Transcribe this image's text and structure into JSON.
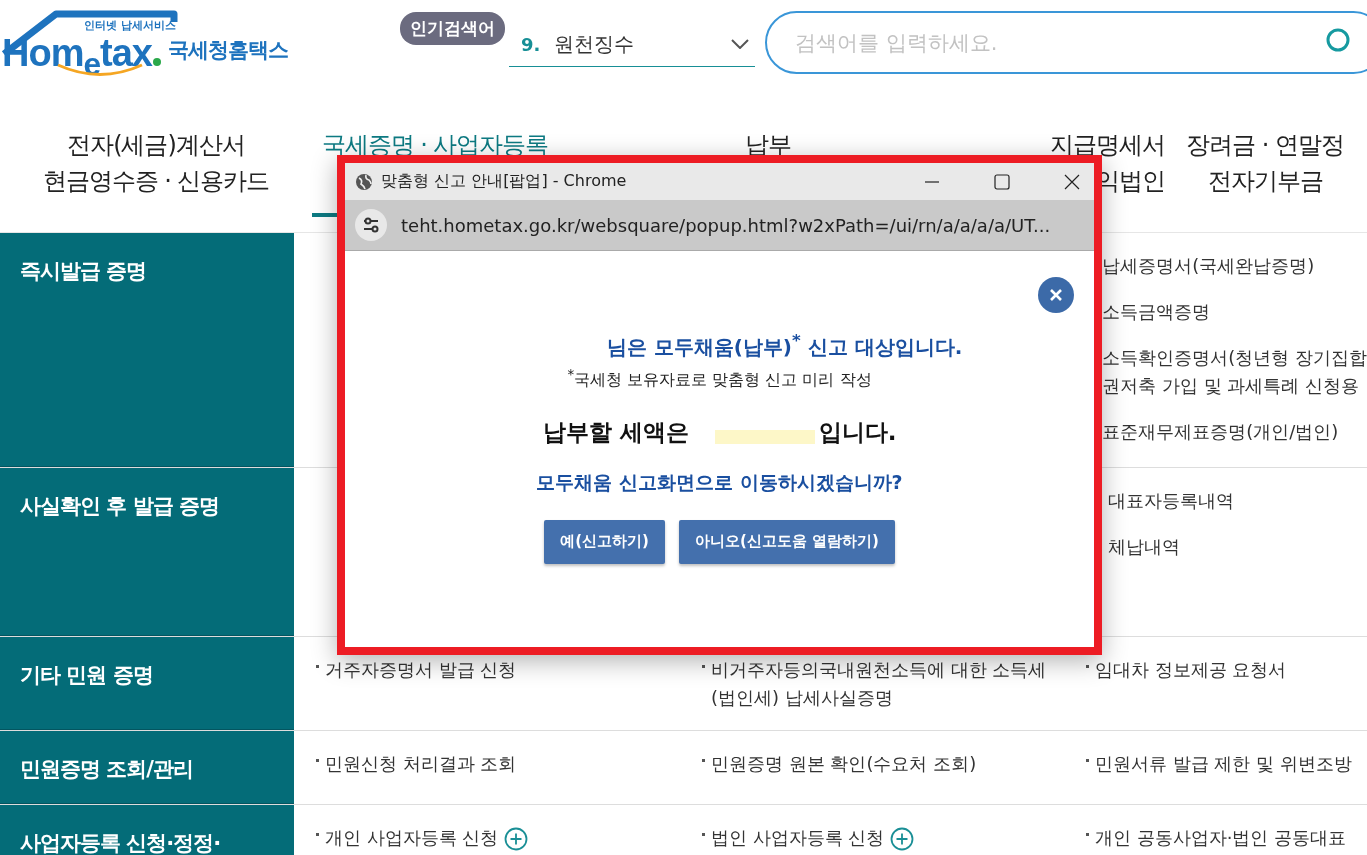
{
  "header": {
    "logo": {
      "tagline": "인터넷 납세서비스",
      "wordmark": "Hom$_{e}$tax",
      "name": "국세청홈택스"
    },
    "popular": {
      "badge": "인기검색어",
      "rank": "9.",
      "term": "원천징수"
    },
    "search": {
      "placeholder": "검색어를 입력하세요."
    }
  },
  "nav": [
    {
      "lines": [
        "전자(세금)계산서",
        "현금영수증 · 신용카드"
      ],
      "selected": false
    },
    {
      "lines": [
        "국세증명 · 사업자등록"
      ],
      "selected": true
    },
    {
      "lines": [
        "납부"
      ],
      "selected": false
    },
    {
      "lines": [
        "지급명세서",
        "익법인"
      ],
      "selected": false
    },
    {
      "lines": [
        "장려금 · 연말정",
        "전자기부금"
      ],
      "selected": false
    }
  ],
  "sections": [
    {
      "title": "즉시발급 증명",
      "column_3": [
        {
          "text": "납세증명서(국세완납증명)"
        },
        {
          "text": "소득금액증명"
        },
        {
          "lines": [
            "소득확인증명서(청년형 장기집합",
            "권저축 가입 및 과세특례 신청용"
          ]
        },
        {
          "text": "표준재무제표증명(개인/법인)"
        }
      ]
    },
    {
      "title": "사실확인 후 발급 증명",
      "column_3": [
        {
          "text": "대표자등록내역"
        },
        {
          "text": "체납내역"
        }
      ]
    },
    {
      "title": "기타 민원 증명",
      "column_1": [
        {
          "text": "거주자증명서 발급 신청"
        }
      ],
      "column_2": [
        {
          "text": "비거주자등의국내원천소득에 대한 소득세(법인세) 납세사실증명"
        }
      ],
      "column_3": [
        {
          "text": "임대차 정보제공 요청서"
        }
      ]
    },
    {
      "title": "민원증명 조회/관리",
      "column_1": [
        {
          "text": "민원신청 처리결과 조회"
        }
      ],
      "column_2": [
        {
          "text": "민원증명 원본 확인(수요처 조회)"
        }
      ],
      "column_3": [
        {
          "text": "민원서류 발급 제한 및 위변조방"
        }
      ]
    },
    {
      "title": "사업자등록 신청·정정·",
      "column_1": [
        {
          "text": "개인 사업자등록 신청",
          "plus": true
        }
      ],
      "column_2": [
        {
          "text": "법인 사업자등록 신청",
          "plus": true
        }
      ],
      "column_3": [
        {
          "text": "개인 공동사업자·법인 공동대표",
          "plus": false
        }
      ]
    }
  ],
  "popup": {
    "title": "맞춤형 신고 안내[팝업] - Chrome",
    "url": "teht.hometax.go.kr/websquare/popup.html?w2xPath=/ui/rn/a/a/a/a/UT...",
    "message": "님은 모두채움(납부)$^{*}$ 신고 대상입니다.",
    "note": "$^{*}$국세청 보유자료로 맞춤형 신고 미리 작성",
    "amount_prefix": "납부할 세액은",
    "amount_suffix": "입니다.",
    "question": "모두채움 신고화면으로 이동하시겠습니까?",
    "buttons": [
      "예(신고하기)",
      "아니오(신고도움 열람하기)"
    ]
  }
}
